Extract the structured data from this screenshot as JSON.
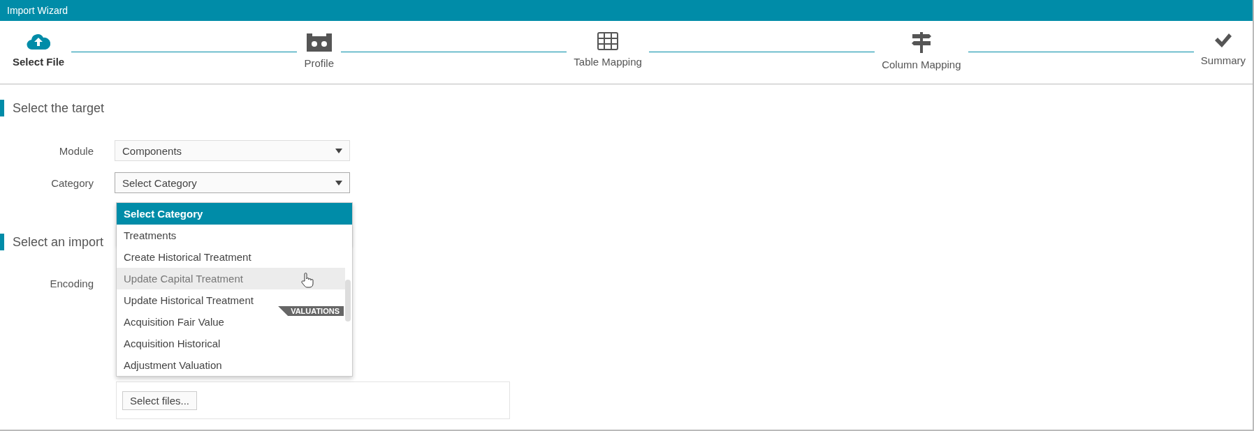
{
  "window": {
    "title": "Import Wizard"
  },
  "steps": [
    {
      "label": "Select File",
      "selected": true
    },
    {
      "label": "Profile",
      "selected": false
    },
    {
      "label": "Table Mapping",
      "selected": false
    },
    {
      "label": "Column Mapping",
      "selected": false
    },
    {
      "label": "Summary",
      "selected": false
    }
  ],
  "sections": [
    {
      "title": "Select the target"
    },
    {
      "title": "Select an import"
    }
  ],
  "module": {
    "label": "Module",
    "value": "Components"
  },
  "category": {
    "label": "Category",
    "value": "Select Category",
    "expanded": true
  },
  "dropdown": {
    "items": [
      {
        "kind": "option",
        "label": "Select Category",
        "selected": true,
        "hovered": false
      },
      {
        "kind": "group_header",
        "label": "Treatments"
      },
      {
        "kind": "option",
        "label": "Create Historical Treatment",
        "selected": false,
        "hovered": false
      },
      {
        "kind": "option",
        "label": "Update Capital Treatment",
        "selected": false,
        "hovered": true
      },
      {
        "kind": "option",
        "label": "Update Historical Treatment",
        "selected": false,
        "hovered": false
      },
      {
        "kind": "group_tag",
        "label": "VALUATIONS"
      },
      {
        "kind": "option",
        "label": "Acquisition Fair Value",
        "selected": false,
        "hovered": false
      },
      {
        "kind": "option",
        "label": "Acquisition Historical",
        "selected": false,
        "hovered": false
      },
      {
        "kind": "option",
        "label": "Adjustment Valuation",
        "selected": false,
        "hovered": false
      }
    ]
  },
  "encoding": {
    "label": "Encoding"
  },
  "upload": {
    "button": "Select files..."
  }
}
